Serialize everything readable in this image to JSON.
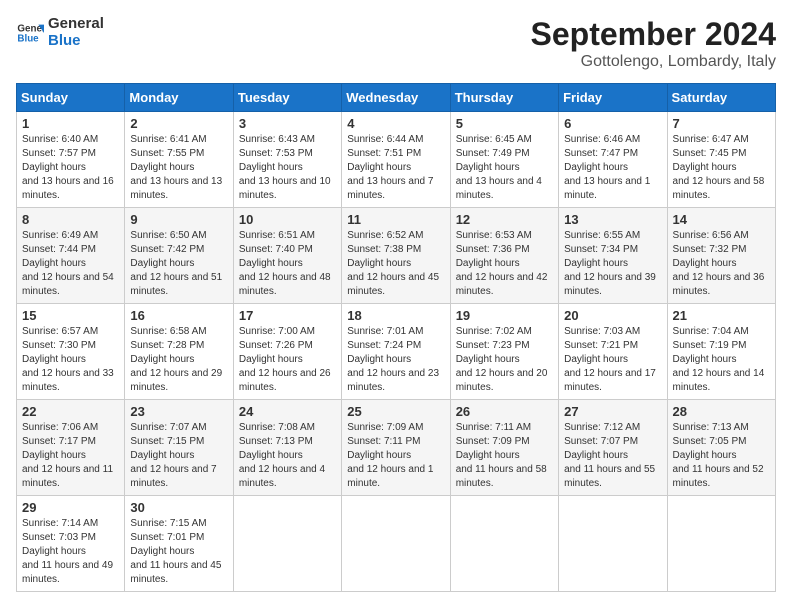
{
  "logo": {
    "line1": "General",
    "line2": "Blue"
  },
  "title": "September 2024",
  "subtitle": "Gottolengo, Lombardy, Italy",
  "weekdays": [
    "Sunday",
    "Monday",
    "Tuesday",
    "Wednesday",
    "Thursday",
    "Friday",
    "Saturday"
  ],
  "weeks": [
    [
      {
        "day": "1",
        "sunrise": "6:40 AM",
        "sunset": "7:57 PM",
        "daylight": "13 hours and 16 minutes."
      },
      {
        "day": "2",
        "sunrise": "6:41 AM",
        "sunset": "7:55 PM",
        "daylight": "13 hours and 13 minutes."
      },
      {
        "day": "3",
        "sunrise": "6:43 AM",
        "sunset": "7:53 PM",
        "daylight": "13 hours and 10 minutes."
      },
      {
        "day": "4",
        "sunrise": "6:44 AM",
        "sunset": "7:51 PM",
        "daylight": "13 hours and 7 minutes."
      },
      {
        "day": "5",
        "sunrise": "6:45 AM",
        "sunset": "7:49 PM",
        "daylight": "13 hours and 4 minutes."
      },
      {
        "day": "6",
        "sunrise": "6:46 AM",
        "sunset": "7:47 PM",
        "daylight": "13 hours and 1 minute."
      },
      {
        "day": "7",
        "sunrise": "6:47 AM",
        "sunset": "7:45 PM",
        "daylight": "12 hours and 58 minutes."
      }
    ],
    [
      {
        "day": "8",
        "sunrise": "6:49 AM",
        "sunset": "7:44 PM",
        "daylight": "12 hours and 54 minutes."
      },
      {
        "day": "9",
        "sunrise": "6:50 AM",
        "sunset": "7:42 PM",
        "daylight": "12 hours and 51 minutes."
      },
      {
        "day": "10",
        "sunrise": "6:51 AM",
        "sunset": "7:40 PM",
        "daylight": "12 hours and 48 minutes."
      },
      {
        "day": "11",
        "sunrise": "6:52 AM",
        "sunset": "7:38 PM",
        "daylight": "12 hours and 45 minutes."
      },
      {
        "day": "12",
        "sunrise": "6:53 AM",
        "sunset": "7:36 PM",
        "daylight": "12 hours and 42 minutes."
      },
      {
        "day": "13",
        "sunrise": "6:55 AM",
        "sunset": "7:34 PM",
        "daylight": "12 hours and 39 minutes."
      },
      {
        "day": "14",
        "sunrise": "6:56 AM",
        "sunset": "7:32 PM",
        "daylight": "12 hours and 36 minutes."
      }
    ],
    [
      {
        "day": "15",
        "sunrise": "6:57 AM",
        "sunset": "7:30 PM",
        "daylight": "12 hours and 33 minutes."
      },
      {
        "day": "16",
        "sunrise": "6:58 AM",
        "sunset": "7:28 PM",
        "daylight": "12 hours and 29 minutes."
      },
      {
        "day": "17",
        "sunrise": "7:00 AM",
        "sunset": "7:26 PM",
        "daylight": "12 hours and 26 minutes."
      },
      {
        "day": "18",
        "sunrise": "7:01 AM",
        "sunset": "7:24 PM",
        "daylight": "12 hours and 23 minutes."
      },
      {
        "day": "19",
        "sunrise": "7:02 AM",
        "sunset": "7:23 PM",
        "daylight": "12 hours and 20 minutes."
      },
      {
        "day": "20",
        "sunrise": "7:03 AM",
        "sunset": "7:21 PM",
        "daylight": "12 hours and 17 minutes."
      },
      {
        "day": "21",
        "sunrise": "7:04 AM",
        "sunset": "7:19 PM",
        "daylight": "12 hours and 14 minutes."
      }
    ],
    [
      {
        "day": "22",
        "sunrise": "7:06 AM",
        "sunset": "7:17 PM",
        "daylight": "12 hours and 11 minutes."
      },
      {
        "day": "23",
        "sunrise": "7:07 AM",
        "sunset": "7:15 PM",
        "daylight": "12 hours and 7 minutes."
      },
      {
        "day": "24",
        "sunrise": "7:08 AM",
        "sunset": "7:13 PM",
        "daylight": "12 hours and 4 minutes."
      },
      {
        "day": "25",
        "sunrise": "7:09 AM",
        "sunset": "7:11 PM",
        "daylight": "12 hours and 1 minute."
      },
      {
        "day": "26",
        "sunrise": "7:11 AM",
        "sunset": "7:09 PM",
        "daylight": "11 hours and 58 minutes."
      },
      {
        "day": "27",
        "sunrise": "7:12 AM",
        "sunset": "7:07 PM",
        "daylight": "11 hours and 55 minutes."
      },
      {
        "day": "28",
        "sunrise": "7:13 AM",
        "sunset": "7:05 PM",
        "daylight": "11 hours and 52 minutes."
      }
    ],
    [
      {
        "day": "29",
        "sunrise": "7:14 AM",
        "sunset": "7:03 PM",
        "daylight": "11 hours and 49 minutes."
      },
      {
        "day": "30",
        "sunrise": "7:15 AM",
        "sunset": "7:01 PM",
        "daylight": "11 hours and 45 minutes."
      },
      null,
      null,
      null,
      null,
      null
    ]
  ]
}
